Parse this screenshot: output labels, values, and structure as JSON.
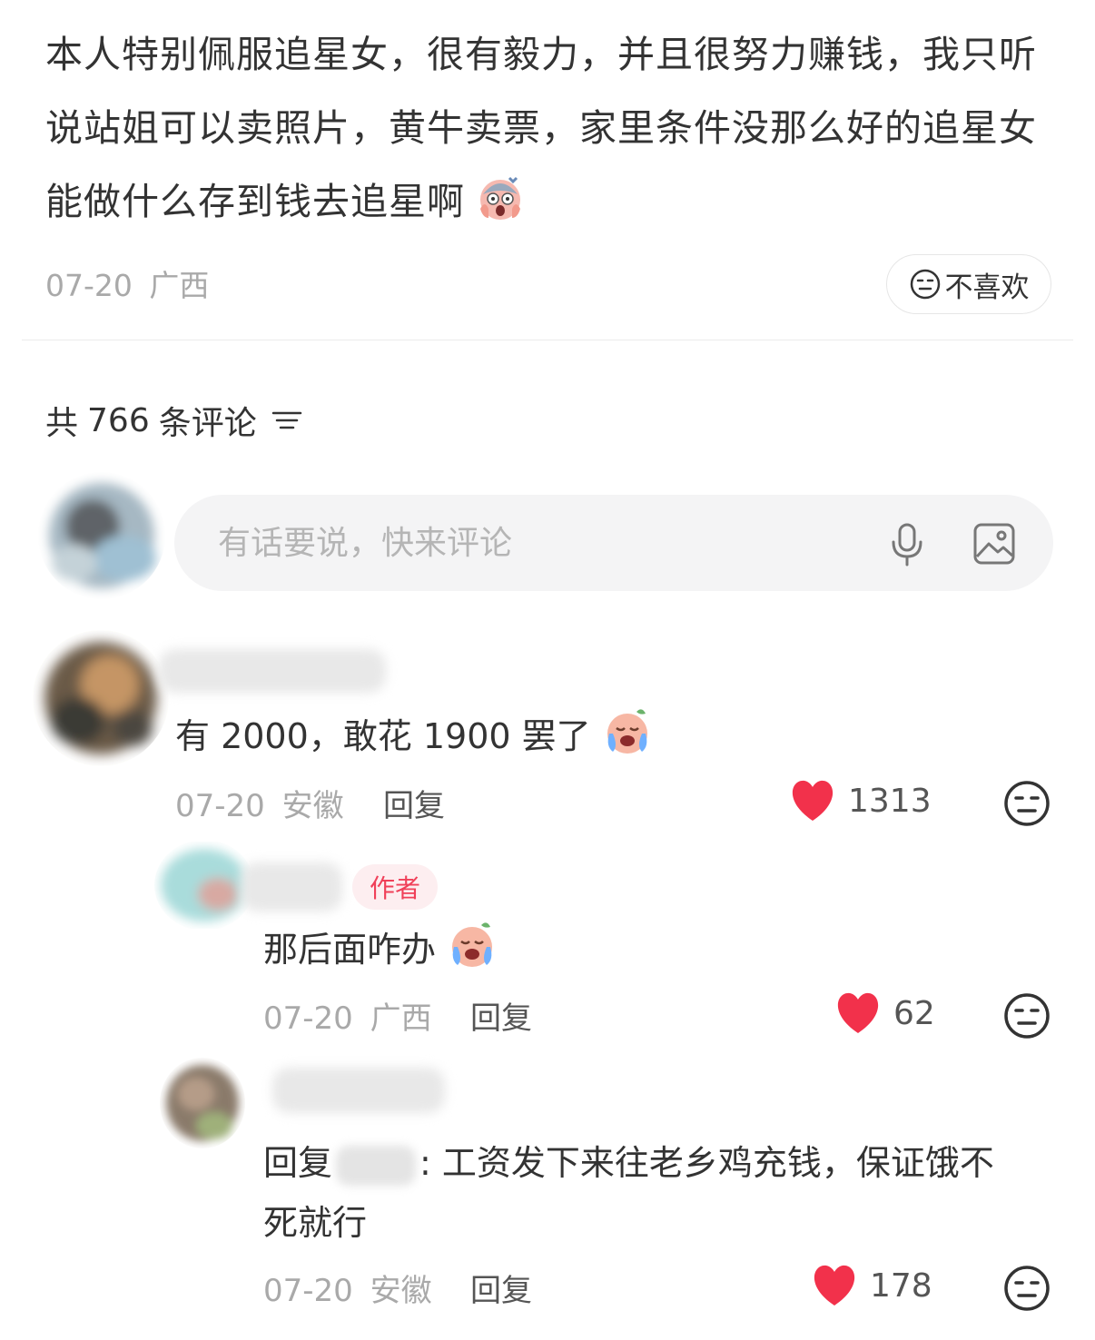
{
  "post": {
    "text": "本人特别佩服追星女，很有毅力，并且很努力赚钱，我只听说站姐可以卖照片，黄牛卖票，家里条件没那么好的追星女能做什么存到钱去追星啊",
    "date": "07-20",
    "location": "广西",
    "dislike_label": "不喜欢"
  },
  "comments_header": {
    "prefix": "共",
    "count": "766",
    "suffix": "条评论"
  },
  "comment_input": {
    "placeholder": "有话要说，快来评论"
  },
  "comments": [
    {
      "text": "有 2000，敢花 1900 罢了",
      "date": "07-20",
      "location": "安徽",
      "reply_label": "回复",
      "likes": "1313"
    },
    {
      "badge": "作者",
      "text": "那后面咋办",
      "date": "07-20",
      "location": "广西",
      "reply_label": "回复",
      "likes": "62"
    },
    {
      "reply_prefix": "回复",
      "text_line1": ": 工资发下来往老乡鸡充钱，保证饿不",
      "text_line2": "死就行",
      "date": "07-20",
      "location": "安徽",
      "reply_label": "回复",
      "likes": "178"
    }
  ],
  "colors": {
    "like_red": "#f2314b",
    "author_badge_bg": "#fdeef0",
    "author_badge_text": "#f04059",
    "meta_gray": "#a9a9a9"
  },
  "icons": [
    "shocked-face-emoji",
    "neutral-face-icon",
    "filter-icon",
    "microphone-icon",
    "image-icon",
    "heart-icon",
    "crying-face-emoji"
  ]
}
